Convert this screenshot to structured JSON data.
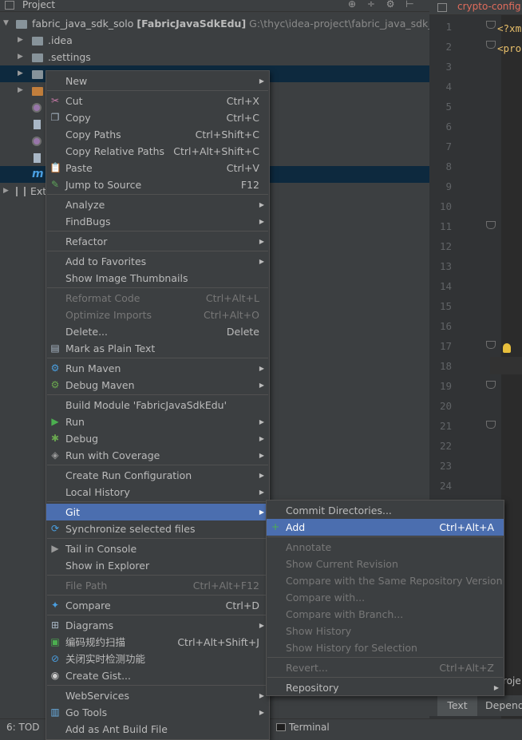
{
  "project_panel": {
    "title": "Project",
    "tools": "⊕ ÷ ⚙ ⊢",
    "tree": [
      {
        "name": "fabric_java_sdk_solo",
        "module": "[FabricJavaSdkEdu]",
        "path": "G:\\thyc\\idea-project\\fabric_java_sdk_solo"
      },
      {
        "name": ".idea"
      },
      {
        "name": ".settings"
      },
      {
        "name": "Ext"
      }
    ]
  },
  "editor": {
    "tab_label": "crypto-config.",
    "line_numbers": [
      "1",
      "2",
      "3",
      "4",
      "5",
      "6",
      "7",
      "8",
      "9",
      "10",
      "11",
      "12",
      "13",
      "14",
      "15",
      "16",
      "17",
      "18",
      "19",
      "20",
      "21",
      "22",
      "23",
      "24"
    ],
    "code_line1": "<?xm",
    "code_line2": "<pro",
    "bottom_tabs": {
      "text": "Text",
      "dependencies": "Depend"
    },
    "proj_edge": "roje"
  },
  "bottom_bar": {
    "todo": "6: TOD",
    "terminal": "Terminal"
  },
  "context_menu": [
    {
      "label": "New",
      "submenu": true
    },
    {
      "label": "Cut",
      "shortcut": "Ctrl+X",
      "icon": "cut-icon"
    },
    {
      "label": "Copy",
      "shortcut": "Ctrl+C",
      "icon": "copy-icon"
    },
    {
      "label": "Copy Paths",
      "shortcut": "Ctrl+Shift+C"
    },
    {
      "label": "Copy Relative Paths",
      "shortcut": "Ctrl+Alt+Shift+C"
    },
    {
      "label": "Paste",
      "shortcut": "Ctrl+V",
      "icon": "paste-icon"
    },
    {
      "label": "Jump to Source",
      "shortcut": "F12",
      "icon": "jump-icon"
    },
    {
      "label": "Analyze",
      "submenu": true
    },
    {
      "label": "FindBugs",
      "submenu": true
    },
    {
      "label": "Refactor",
      "submenu": true
    },
    {
      "label": "Add to Favorites",
      "submenu": true
    },
    {
      "label": "Show Image Thumbnails"
    },
    {
      "label": "Reformat Code",
      "shortcut": "Ctrl+Alt+L",
      "disabled": true
    },
    {
      "label": "Optimize Imports",
      "shortcut": "Ctrl+Alt+O",
      "disabled": true
    },
    {
      "label": "Delete...",
      "shortcut": "Delete"
    },
    {
      "label": "Mark as Plain Text",
      "icon": "plain-text-icon"
    },
    {
      "label": "Run Maven",
      "submenu": true,
      "icon": "maven-icon"
    },
    {
      "label": "Debug Maven",
      "submenu": true,
      "icon": "debug-maven-icon"
    },
    {
      "label": "Build Module 'FabricJavaSdkEdu'"
    },
    {
      "label": "Run",
      "submenu": true,
      "icon": "run-icon"
    },
    {
      "label": "Debug",
      "submenu": true,
      "icon": "debug-icon"
    },
    {
      "label": "Run with Coverage",
      "submenu": true,
      "icon": "coverage-icon"
    },
    {
      "label": "Create Run Configuration",
      "submenu": true
    },
    {
      "label": "Local History",
      "submenu": true
    },
    {
      "label": "Git",
      "submenu": true,
      "highlighted": true
    },
    {
      "label": "Synchronize selected files",
      "icon": "sync-icon"
    },
    {
      "label": "Tail in Console",
      "icon": "tail-icon"
    },
    {
      "label": "Show in Explorer"
    },
    {
      "label": "File Path",
      "shortcut": "Ctrl+Alt+F12",
      "disabled": true
    },
    {
      "label": "Compare",
      "shortcut": "Ctrl+D",
      "icon": "compare-icon"
    },
    {
      "label": "Diagrams",
      "submenu": true,
      "icon": "diagram-icon"
    },
    {
      "label": "编码规约扫描",
      "shortcut": "Ctrl+Alt+Shift+J",
      "icon": "scan-icon"
    },
    {
      "label": "关闭实时检测功能",
      "icon": "disable-icon"
    },
    {
      "label": "Create Gist...",
      "icon": "github-icon"
    },
    {
      "label": "WebServices",
      "submenu": true
    },
    {
      "label": "Go Tools",
      "submenu": true,
      "icon": "go-icon"
    },
    {
      "label": "Add as Ant Build File"
    }
  ],
  "git_submenu": [
    {
      "label": "Commit Directories..."
    },
    {
      "label": "Add",
      "shortcut": "Ctrl+Alt+A",
      "highlighted": true,
      "icon": "add-icon"
    },
    {
      "label": "Annotate",
      "disabled": true
    },
    {
      "label": "Show Current Revision",
      "disabled": true
    },
    {
      "label": "Compare with the Same Repository Version",
      "disabled": true
    },
    {
      "label": "Compare with...",
      "disabled": true
    },
    {
      "label": "Compare with Branch...",
      "disabled": true
    },
    {
      "label": "Show History",
      "disabled": true
    },
    {
      "label": "Show History for Selection",
      "disabled": true
    },
    {
      "label": "Revert...",
      "shortcut": "Ctrl+Alt+Z",
      "disabled": true
    },
    {
      "label": "Repository",
      "submenu": true
    }
  ]
}
